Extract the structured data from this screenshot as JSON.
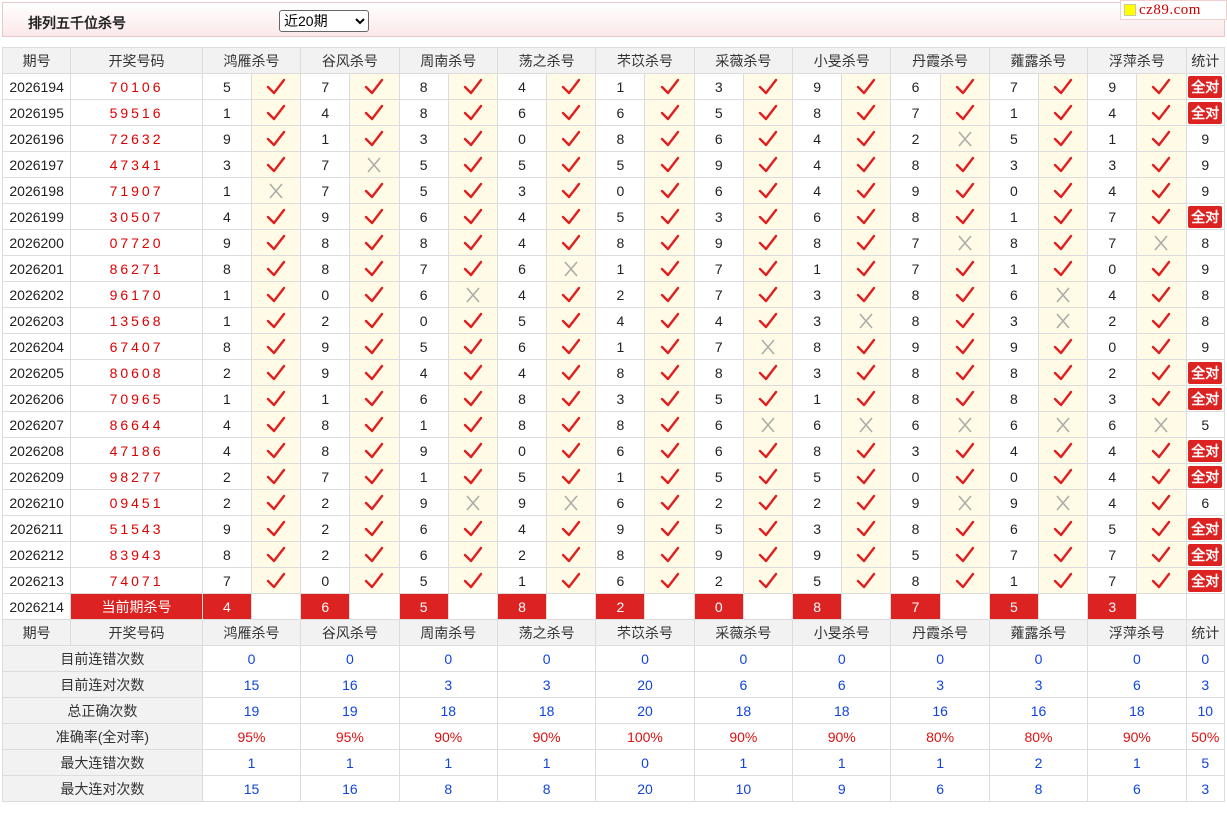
{
  "header": {
    "title": "排列五千位杀号",
    "range_selected": "近20期",
    "logo_text": "cz89.com"
  },
  "columns": {
    "period": "期号",
    "draw": "开奖号码",
    "experts": [
      "鸿雁杀号",
      "谷风杀号",
      "周南杀号",
      "荡之杀号",
      "芣苡杀号",
      "采薇杀号",
      "小旻杀号",
      "丹霞杀号",
      "蕹露杀号",
      "浮萍杀号"
    ],
    "stat": "统计"
  },
  "full_correct_label": "全对",
  "rows": [
    {
      "period": "2026194",
      "draw": "70106",
      "kills": [
        5,
        7,
        8,
        4,
        1,
        3,
        9,
        6,
        7,
        9
      ],
      "ok": [
        1,
        1,
        1,
        1,
        1,
        1,
        1,
        1,
        1,
        1
      ],
      "stat": "全对"
    },
    {
      "period": "2026195",
      "draw": "59516",
      "kills": [
        1,
        4,
        8,
        6,
        6,
        5,
        8,
        7,
        1,
        4
      ],
      "ok": [
        1,
        1,
        1,
        1,
        1,
        1,
        1,
        1,
        1,
        1
      ],
      "stat": "全对"
    },
    {
      "period": "2026196",
      "draw": "72632",
      "kills": [
        9,
        1,
        3,
        0,
        8,
        6,
        4,
        2,
        5,
        1
      ],
      "ok": [
        1,
        1,
        1,
        1,
        1,
        1,
        1,
        0,
        1,
        1
      ],
      "stat": "9"
    },
    {
      "period": "2026197",
      "draw": "47341",
      "kills": [
        3,
        7,
        5,
        5,
        5,
        9,
        4,
        8,
        3,
        3
      ],
      "ok": [
        1,
        0,
        1,
        1,
        1,
        1,
        1,
        1,
        1,
        1
      ],
      "stat": "9"
    },
    {
      "period": "2026198",
      "draw": "71907",
      "kills": [
        1,
        7,
        5,
        3,
        0,
        6,
        4,
        9,
        0,
        4
      ],
      "ok": [
        0,
        1,
        1,
        1,
        1,
        1,
        1,
        1,
        1,
        1
      ],
      "stat": "9"
    },
    {
      "period": "2026199",
      "draw": "30507",
      "kills": [
        4,
        9,
        6,
        4,
        5,
        3,
        6,
        8,
        1,
        7
      ],
      "ok": [
        1,
        1,
        1,
        1,
        1,
        1,
        1,
        1,
        1,
        1
      ],
      "stat": "全对"
    },
    {
      "period": "2026200",
      "draw": "07720",
      "kills": [
        9,
        8,
        8,
        4,
        8,
        9,
        8,
        7,
        8,
        7
      ],
      "ok": [
        1,
        1,
        1,
        1,
        1,
        1,
        1,
        0,
        1,
        0
      ],
      "stat": "8"
    },
    {
      "period": "2026201",
      "draw": "86271",
      "kills": [
        8,
        8,
        7,
        6,
        1,
        7,
        1,
        7,
        1,
        0
      ],
      "ok": [
        1,
        1,
        1,
        0,
        1,
        1,
        1,
        1,
        1,
        1
      ],
      "stat": "9"
    },
    {
      "period": "2026202",
      "draw": "96170",
      "kills": [
        1,
        0,
        6,
        4,
        2,
        7,
        3,
        8,
        6,
        4
      ],
      "ok": [
        1,
        1,
        0,
        1,
        1,
        1,
        1,
        1,
        0,
        1
      ],
      "stat": "8"
    },
    {
      "period": "2026203",
      "draw": "13568",
      "kills": [
        1,
        2,
        0,
        5,
        4,
        4,
        3,
        8,
        3,
        2
      ],
      "ok": [
        1,
        1,
        1,
        1,
        1,
        1,
        0,
        1,
        0,
        1
      ],
      "stat": "8"
    },
    {
      "period": "2026204",
      "draw": "67407",
      "kills": [
        8,
        9,
        5,
        6,
        1,
        7,
        8,
        9,
        9,
        0
      ],
      "ok": [
        1,
        1,
        1,
        1,
        1,
        0,
        1,
        1,
        1,
        1
      ],
      "stat": "9"
    },
    {
      "period": "2026205",
      "draw": "80608",
      "kills": [
        2,
        9,
        4,
        4,
        8,
        8,
        3,
        8,
        8,
        2
      ],
      "ok": [
        1,
        1,
        1,
        1,
        1,
        1,
        1,
        1,
        1,
        1
      ],
      "stat": "全对"
    },
    {
      "period": "2026206",
      "draw": "70965",
      "kills": [
        1,
        1,
        6,
        8,
        3,
        5,
        1,
        8,
        8,
        3
      ],
      "ok": [
        1,
        1,
        1,
        1,
        1,
        1,
        1,
        1,
        1,
        1
      ],
      "stat": "全对"
    },
    {
      "period": "2026207",
      "draw": "86644",
      "kills": [
        4,
        8,
        1,
        8,
        8,
        6,
        6,
        6,
        6,
        6
      ],
      "ok": [
        1,
        1,
        1,
        1,
        1,
        0,
        0,
        0,
        0,
        0
      ],
      "stat": "5"
    },
    {
      "period": "2026208",
      "draw": "47186",
      "kills": [
        4,
        8,
        9,
        0,
        6,
        6,
        8,
        3,
        4,
        4
      ],
      "ok": [
        1,
        1,
        1,
        1,
        1,
        1,
        1,
        1,
        1,
        1
      ],
      "stat": "全对"
    },
    {
      "period": "2026209",
      "draw": "98277",
      "kills": [
        2,
        7,
        1,
        5,
        1,
        5,
        5,
        0,
        0,
        4
      ],
      "ok": [
        1,
        1,
        1,
        1,
        1,
        1,
        1,
        1,
        1,
        1
      ],
      "stat": "全对"
    },
    {
      "period": "2026210",
      "draw": "09451",
      "kills": [
        2,
        2,
        9,
        9,
        6,
        2,
        2,
        9,
        9,
        4
      ],
      "ok": [
        1,
        1,
        0,
        0,
        1,
        1,
        1,
        0,
        0,
        1
      ],
      "stat": "6"
    },
    {
      "period": "2026211",
      "draw": "51543",
      "kills": [
        9,
        2,
        6,
        4,
        9,
        5,
        3,
        8,
        6,
        5
      ],
      "ok": [
        1,
        1,
        1,
        1,
        1,
        1,
        1,
        1,
        1,
        1
      ],
      "stat": "全对"
    },
    {
      "period": "2026212",
      "draw": "83943",
      "kills": [
        8,
        2,
        6,
        2,
        8,
        9,
        9,
        5,
        7,
        7
      ],
      "ok": [
        1,
        1,
        1,
        1,
        1,
        1,
        1,
        1,
        1,
        1
      ],
      "stat": "全对"
    },
    {
      "period": "2026213",
      "draw": "74071",
      "kills": [
        7,
        0,
        5,
        1,
        6,
        2,
        5,
        8,
        1,
        7
      ],
      "ok": [
        1,
        1,
        1,
        1,
        1,
        1,
        1,
        1,
        1,
        1
      ],
      "stat": "全对"
    }
  ],
  "current": {
    "period": "2026214",
    "label": "当前期杀号",
    "kills": [
      4,
      6,
      5,
      8,
      2,
      0,
      8,
      7,
      5,
      3
    ]
  },
  "summary": [
    {
      "label": "目前连错次数",
      "values": [
        "0",
        "0",
        "0",
        "0",
        "0",
        "0",
        "0",
        "0",
        "0",
        "0"
      ],
      "stat": "0",
      "color": "blue"
    },
    {
      "label": "目前连对次数",
      "values": [
        "15",
        "16",
        "3",
        "3",
        "20",
        "6",
        "6",
        "3",
        "3",
        "6"
      ],
      "stat": "3",
      "color": "blue"
    },
    {
      "label": "总正确次数",
      "values": [
        "19",
        "19",
        "18",
        "18",
        "20",
        "18",
        "18",
        "16",
        "16",
        "18"
      ],
      "stat": "10",
      "color": "blue"
    },
    {
      "label": "准确率(全对率)",
      "values": [
        "95%",
        "95%",
        "90%",
        "90%",
        "100%",
        "90%",
        "90%",
        "80%",
        "80%",
        "90%"
      ],
      "stat": "50%",
      "color": "red"
    },
    {
      "label": "最大连错次数",
      "values": [
        "1",
        "1",
        "1",
        "1",
        "0",
        "1",
        "1",
        "1",
        "2",
        "1"
      ],
      "stat": "5",
      "color": "blue"
    },
    {
      "label": "最大连对次数",
      "values": [
        "15",
        "16",
        "8",
        "8",
        "20",
        "10",
        "9",
        "6",
        "8",
        "6"
      ],
      "stat": "3",
      "color": "blue"
    }
  ],
  "colors": {
    "accent": "#dd2222",
    "check": "#e02020",
    "cross": "#aaaaaa",
    "summary_blue": "#1144dd"
  }
}
